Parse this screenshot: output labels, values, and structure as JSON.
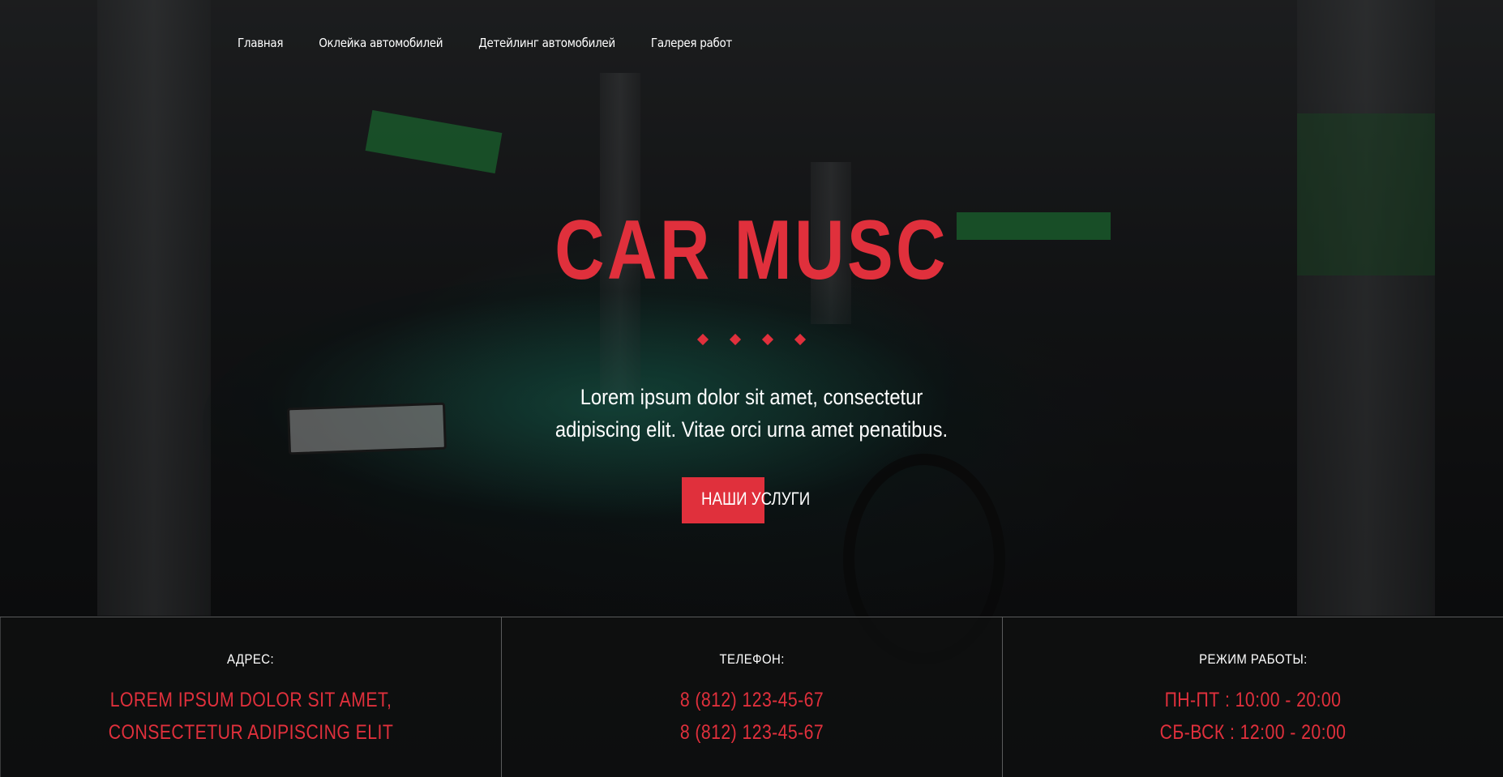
{
  "nav": {
    "items": [
      {
        "label": "Главная"
      },
      {
        "label": "Оклейка автомобилей"
      },
      {
        "label": "Детейлинг автомобилей"
      },
      {
        "label": "Галерея работ"
      }
    ]
  },
  "hero": {
    "title": "CAR MUSC",
    "text_line1": "Lorem ipsum dolor sit amet, consectetur",
    "text_line2": "adipiscing elit. Vitae orci urna amet penatibus.",
    "cta_label": "НАШИ УСЛУГИ"
  },
  "info": {
    "address": {
      "heading": "АДРЕС:",
      "line1": "LOREM IPSUM DOLOR SIT AMET,",
      "line2": "CONSECTETUR ADIPISCING ELIT"
    },
    "phone": {
      "heading": "ТЕЛЕФОН:",
      "line1": "8 (812) 123-45-67",
      "line2": "8 (812) 123-45-67"
    },
    "hours": {
      "heading": "РЕЖИМ РАБОТЫ:",
      "line1": "ПН-ПТ : 10:00 - 20:00",
      "line2": "СБ-ВСК : 12:00 - 20:00"
    }
  },
  "colors": {
    "accent": "#e0303c",
    "background": "#0e0f10",
    "divider": "#5a5b5c"
  }
}
